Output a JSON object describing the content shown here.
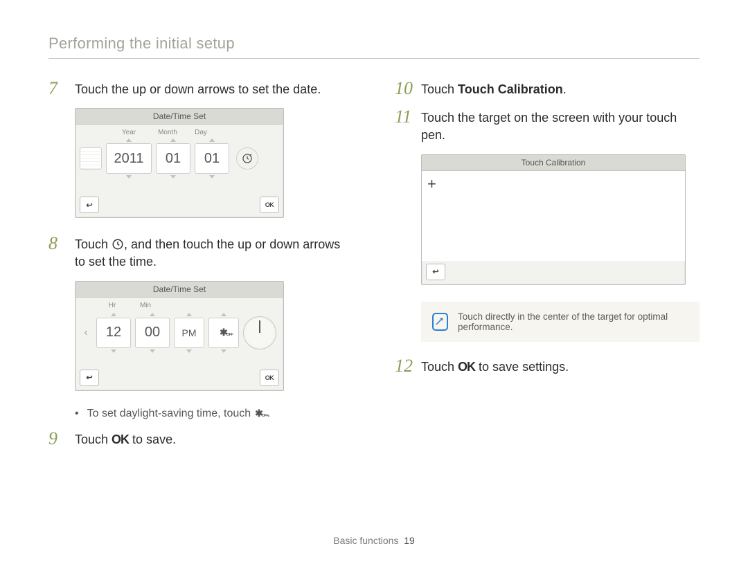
{
  "header": {
    "title": "Performing the initial setup"
  },
  "footer": {
    "section": "Basic functions",
    "page": "19"
  },
  "left": {
    "step7": {
      "num": "7",
      "text": "Touch the up or down arrows to set the date."
    },
    "shot_date": {
      "title": "Date/Time Set",
      "labels": {
        "year": "Year",
        "month": "Month",
        "day": "Day"
      },
      "year": "2011",
      "month": "01",
      "day": "01",
      "back": "↩",
      "ok": "OK"
    },
    "step8": {
      "num": "8",
      "text_a": "Touch ",
      "text_b": ", and then touch the up or down arrows to set the time."
    },
    "shot_time": {
      "title": "Date/Time Set",
      "labels": {
        "hr": "Hr",
        "min": "Min"
      },
      "hr": "12",
      "min": "00",
      "ampm": "PM",
      "back": "↩",
      "ok": "OK"
    },
    "bullet_dst": "To set daylight-saving time, touch ",
    "step9": {
      "num": "9",
      "text_a": "Touch ",
      "ok": "OK",
      "text_b": " to save."
    }
  },
  "right": {
    "step10": {
      "num": "10",
      "text_a": "Touch ",
      "bold": "Touch Calibration",
      "text_b": "."
    },
    "step11": {
      "num": "11",
      "text": "Touch the target on the screen with your touch pen."
    },
    "shot_calib": {
      "title": "Touch Calibration",
      "back": "↩"
    },
    "note": {
      "text": "Touch directly in the center of the target for optimal performance."
    },
    "step12": {
      "num": "12",
      "text_a": "Touch ",
      "ok": "OK",
      "text_b": " to save settings."
    }
  }
}
